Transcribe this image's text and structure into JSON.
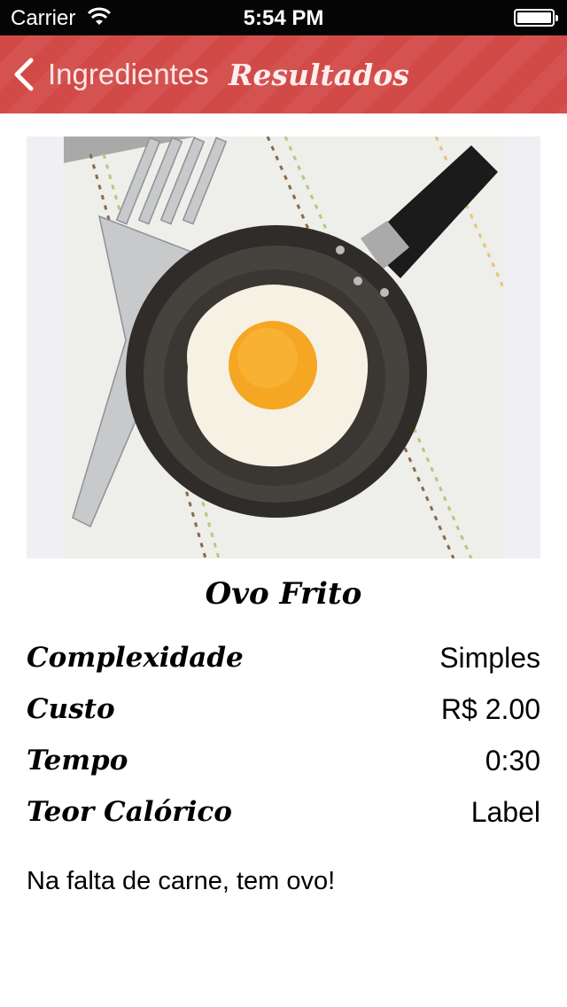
{
  "status_bar": {
    "carrier": "Carrier",
    "time": "5:54 PM",
    "battery_level": 1.0
  },
  "nav": {
    "back_label": "Ingredientes",
    "title": "Resultados",
    "back_icon": "chevron-left-icon",
    "bar_color": "#d24a48"
  },
  "recipe": {
    "image": "fried-egg-in-pan",
    "name": "Ovo Frito",
    "details": [
      {
        "label": "Complexidade",
        "value": "Simples"
      },
      {
        "label": "Custo",
        "value": "R$ 2.00"
      },
      {
        "label": "Tempo",
        "value": "0:30"
      },
      {
        "label": "Teor Calórico",
        "value": "Label"
      }
    ],
    "description": "Na falta de carne, tem ovo!"
  }
}
